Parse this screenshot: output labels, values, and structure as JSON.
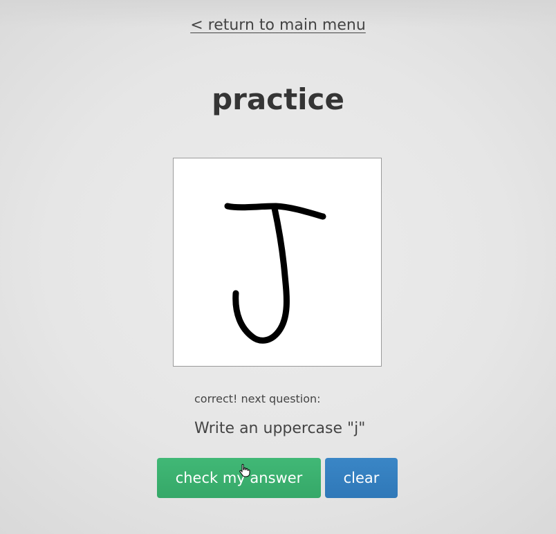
{
  "nav": {
    "back_link": "< return to main menu"
  },
  "page": {
    "title": "practice"
  },
  "drawing": {
    "stroke_color": "#000000",
    "background": "#ffffff"
  },
  "feedback": {
    "status": "correct! next question:",
    "prompt": "Write an uppercase \"j\""
  },
  "actions": {
    "check_label": "check my answer",
    "clear_label": "clear",
    "check_color": "#3cb371",
    "clear_color": "#337ab7"
  },
  "cursor": {
    "icon": "hand-pointer-icon"
  }
}
